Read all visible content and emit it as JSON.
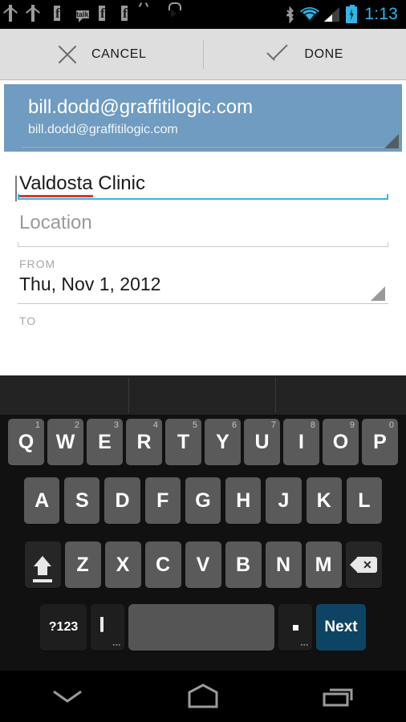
{
  "status_bar": {
    "time": "1:13",
    "notifications": [
      {
        "name": "gmail-icon",
        "label": "Gmail"
      },
      {
        "name": "gmail-icon",
        "label": "Gmail"
      },
      {
        "name": "facebook-icon",
        "label": "f"
      },
      {
        "name": "talk-icon",
        "label": "talk"
      },
      {
        "name": "facebook-icon",
        "label": "f"
      },
      {
        "name": "facebook-icon",
        "label": "f"
      },
      {
        "name": "android-icon",
        "label": "Android"
      },
      {
        "name": "play-store-icon",
        "label": "Play Store"
      }
    ],
    "system_icons": [
      "bluetooth-icon",
      "wifi-icon",
      "cell-signal-icon",
      "battery-charging-icon"
    ],
    "accent_color": "#33b5e5"
  },
  "action_bar": {
    "cancel_label": "CANCEL",
    "done_label": "DONE"
  },
  "form": {
    "account": {
      "calendar_name": "bill.dodd@graffitilogic.com",
      "account_email": "bill.dodd@graffitilogic.com",
      "background_color": "#6f9cc0"
    },
    "title_field": {
      "value_misspelled": "Valdosta",
      "value_rest": " Clinic",
      "full_value": "Valdosta Clinic",
      "focus_color": "#33b5e5",
      "spellcheck_color": "#e8332a"
    },
    "location_field": {
      "placeholder": "Location",
      "value": ""
    },
    "from": {
      "label": "FROM",
      "date": "Thu, Nov 1, 2012"
    },
    "to": {
      "label": "TO"
    }
  },
  "keyboard": {
    "suggestions": [
      "",
      "",
      ""
    ],
    "row1": [
      {
        "letter": "Q",
        "num": "1"
      },
      {
        "letter": "W",
        "num": "2"
      },
      {
        "letter": "E",
        "num": "3"
      },
      {
        "letter": "R",
        "num": "4"
      },
      {
        "letter": "T",
        "num": "5"
      },
      {
        "letter": "Y",
        "num": "6"
      },
      {
        "letter": "U",
        "num": "7"
      },
      {
        "letter": "I",
        "num": "8"
      },
      {
        "letter": "O",
        "num": "9"
      },
      {
        "letter": "P",
        "num": "0"
      }
    ],
    "row2": [
      "A",
      "S",
      "D",
      "F",
      "G",
      "H",
      "J",
      "K",
      "L"
    ],
    "row3": [
      "Z",
      "X",
      "C",
      "V",
      "B",
      "N",
      "M"
    ],
    "shift_label": "shift",
    "backspace_label": "delete",
    "symbols_label": "?123",
    "mic_label": "voice input",
    "space_label": "space",
    "period_label": ".",
    "enter_label": "Next",
    "enter_color": "#0e4463"
  },
  "nav_bar": {
    "back_label": "hide keyboard",
    "home_label": "home",
    "recents_label": "recent apps"
  }
}
